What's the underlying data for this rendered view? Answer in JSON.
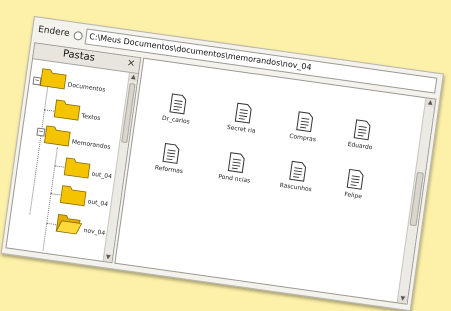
{
  "address": {
    "label": "Endere",
    "path": "C:\\Meus Documentos\\documentos\\memorandos\\nov_04"
  },
  "folders_pane": {
    "title": "Pastas",
    "close": "×",
    "tree": [
      {
        "label": "Documentos",
        "expander": "−"
      },
      {
        "label": "Textos",
        "expander": ""
      },
      {
        "label": "Memorandos",
        "expander": "−"
      },
      {
        "label": "out_04",
        "expander": ""
      },
      {
        "label": "out_04",
        "expander": ""
      },
      {
        "label": "nov_04",
        "expander": ""
      }
    ]
  },
  "files": [
    {
      "label": "Dr_carlos"
    },
    {
      "label": "Secret ria"
    },
    {
      "label": "Compras"
    },
    {
      "label": "Eduardo"
    },
    {
      "label": "Reformas"
    },
    {
      "label": "Pond ncias"
    },
    {
      "label": "Rascunhos"
    },
    {
      "label": "Felipe"
    }
  ],
  "scroll": {
    "up": "▲",
    "down": "▼"
  }
}
